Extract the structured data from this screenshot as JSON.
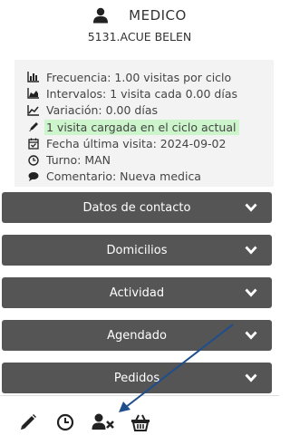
{
  "header": {
    "title": "MEDICO",
    "code_line": "5131.ACUE BELEN"
  },
  "info": {
    "frecuencia": "Frecuencia: 1.00 visitas por ciclo",
    "intervalos": "Intervalos: 1 visita cada 0.00 días",
    "variacion": "Variación: 0.00 días",
    "visita_cargada": "1 visita cargada en el ciclo actual",
    "fecha_ultima": "Fecha última visita: 2024-09-02",
    "turno": "Turno: MAN",
    "comentario": "Comentario: Nueva medica"
  },
  "sections": {
    "datos_contacto": "Datos de contacto",
    "domicilios": "Domicilios",
    "actividad": "Actividad",
    "agendado": "Agendado",
    "pedidos": "Pedidos"
  },
  "colors": {
    "section_bg": "#555555",
    "highlight": "#ccf5cc",
    "annotation_arrow": "#1e4e8c"
  },
  "bottom_icons": [
    "pencil-icon",
    "clock-icon",
    "user-remove-icon",
    "basket-icon"
  ]
}
